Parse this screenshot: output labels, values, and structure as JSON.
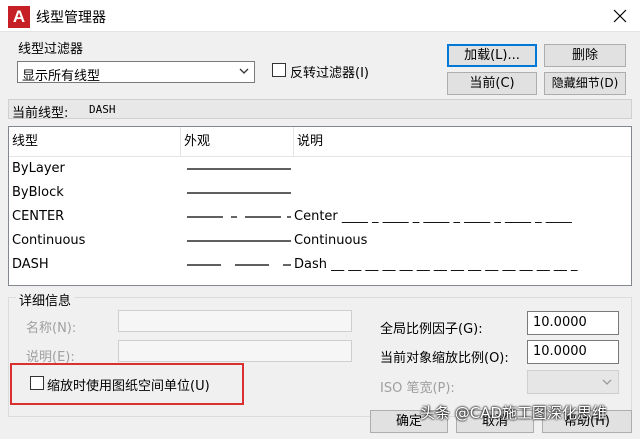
{
  "window": {
    "title": "线型管理器",
    "app_logo": "A"
  },
  "filter": {
    "group_label": "线型过滤器",
    "selected": "显示所有线型",
    "invert_label": "反转过滤器(I)",
    "invert_checked": false
  },
  "buttons": {
    "load": "加载(L)...",
    "delete": "删除",
    "current": "当前(C)",
    "hide_details": "隐藏细节(D)",
    "ok": "确定",
    "cancel": "取消",
    "help": "帮助(H)"
  },
  "current_linetype": {
    "label": "当前线型:",
    "value": "DASH"
  },
  "table": {
    "headers": [
      "线型",
      "外观",
      "说明"
    ],
    "rows": [
      {
        "name": "ByLayer",
        "pattern": "solid",
        "desc": ""
      },
      {
        "name": "ByBlock",
        "pattern": "solid",
        "desc": ""
      },
      {
        "name": "CENTER",
        "pattern": "center",
        "desc": "Center ____ _ ____ _ ____ _ ____ _ ____ _ ____"
      },
      {
        "name": "Continuous",
        "pattern": "solid",
        "desc": "Continuous"
      },
      {
        "name": "DASH",
        "pattern": "dash",
        "desc": "Dash __ __ __ __ __ __ __ __ __ __ __ __ __ __ _"
      }
    ]
  },
  "details": {
    "group_label": "详细信息",
    "name_label": "名称(N):",
    "desc_label": "说明(E):",
    "global_scale_label": "全局比例因子(G):",
    "global_scale_value": "10.0000",
    "object_scale_label": "当前对象缩放比例(O):",
    "object_scale_value": "10.0000",
    "iso_pen_label": "ISO 笔宽(P):",
    "paper_space_label": "缩放时使用图纸空间单位(U)",
    "paper_space_checked": false
  },
  "watermark": "头条 @CAD施工图深化思维",
  "colors": {
    "highlight": "#d93030",
    "default_button_border": "#0078d7",
    "app_icon": "#c62026"
  }
}
